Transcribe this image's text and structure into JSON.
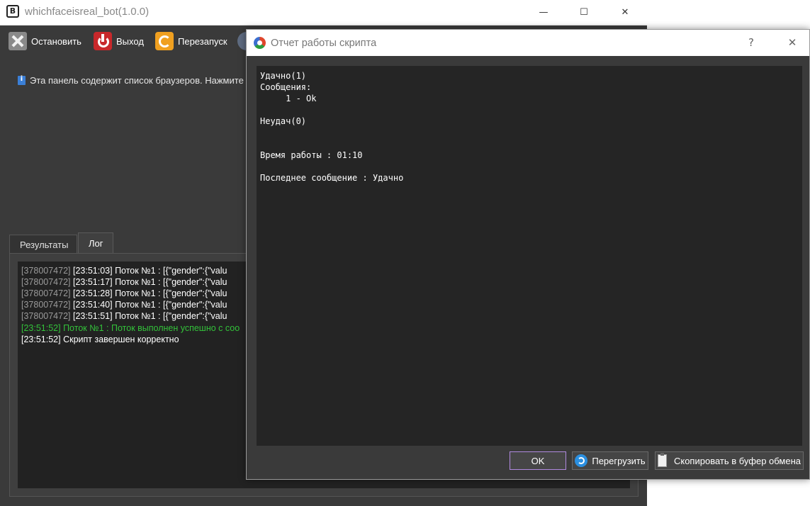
{
  "main_window": {
    "title": "whichfaceisreal_bot(1.0.0)",
    "controls": {
      "minimize": "—",
      "maximize": "☐",
      "close": "✕"
    },
    "app_icon_letter": "B",
    "toolbar": {
      "stop_label": "Остановить",
      "exit_label": "Выход",
      "restart_label": "Перезапуск"
    },
    "info_text": "Эта панель содержит список браузеров. Нажмите н",
    "tabs": [
      {
        "label": "Результаты"
      },
      {
        "label": "Лог"
      }
    ],
    "log": [
      {
        "id": "[378007472]",
        "text": " [23:51:03] Поток №1 : [{\"gender\":{\"valu"
      },
      {
        "id": "[378007472]",
        "text": " [23:51:17] Поток №1 : [{\"gender\":{\"valu"
      },
      {
        "id": "[378007472]",
        "text": " [23:51:28] Поток №1 : [{\"gender\":{\"valu"
      },
      {
        "id": "[378007472]",
        "text": " [23:51:40] Поток №1 : [{\"gender\":{\"valu"
      },
      {
        "id": "[378007472]",
        "text": " [23:51:51] Поток №1 : [{\"gender\":{\"valu"
      },
      {
        "text": "[23:51:52] Поток №1 : Поток выполнен успешно с соо"
      },
      {
        "text": "[23:51:52] Скрипт завершен корректно"
      }
    ]
  },
  "dialog": {
    "title": "Отчет работы скрипта",
    "help": "?",
    "close": "✕",
    "report": {
      "success": "Удачно(1)",
      "messages_header": "Сообщения:",
      "message_1": "     1 - Ok",
      "fail": "Неудач(0)",
      "runtime": "Время работы : 01:10",
      "last_message": "Последнее сообщение : Удачно"
    },
    "buttons": {
      "ok": "OK",
      "reload": "Перегрузить",
      "copy": "Скопировать в буфер обмена"
    }
  },
  "colors": {
    "window_bg": "#3a3a3a",
    "log_bg": "#222222",
    "success_text": "#33c23a",
    "ok_border": "#b08adf"
  }
}
